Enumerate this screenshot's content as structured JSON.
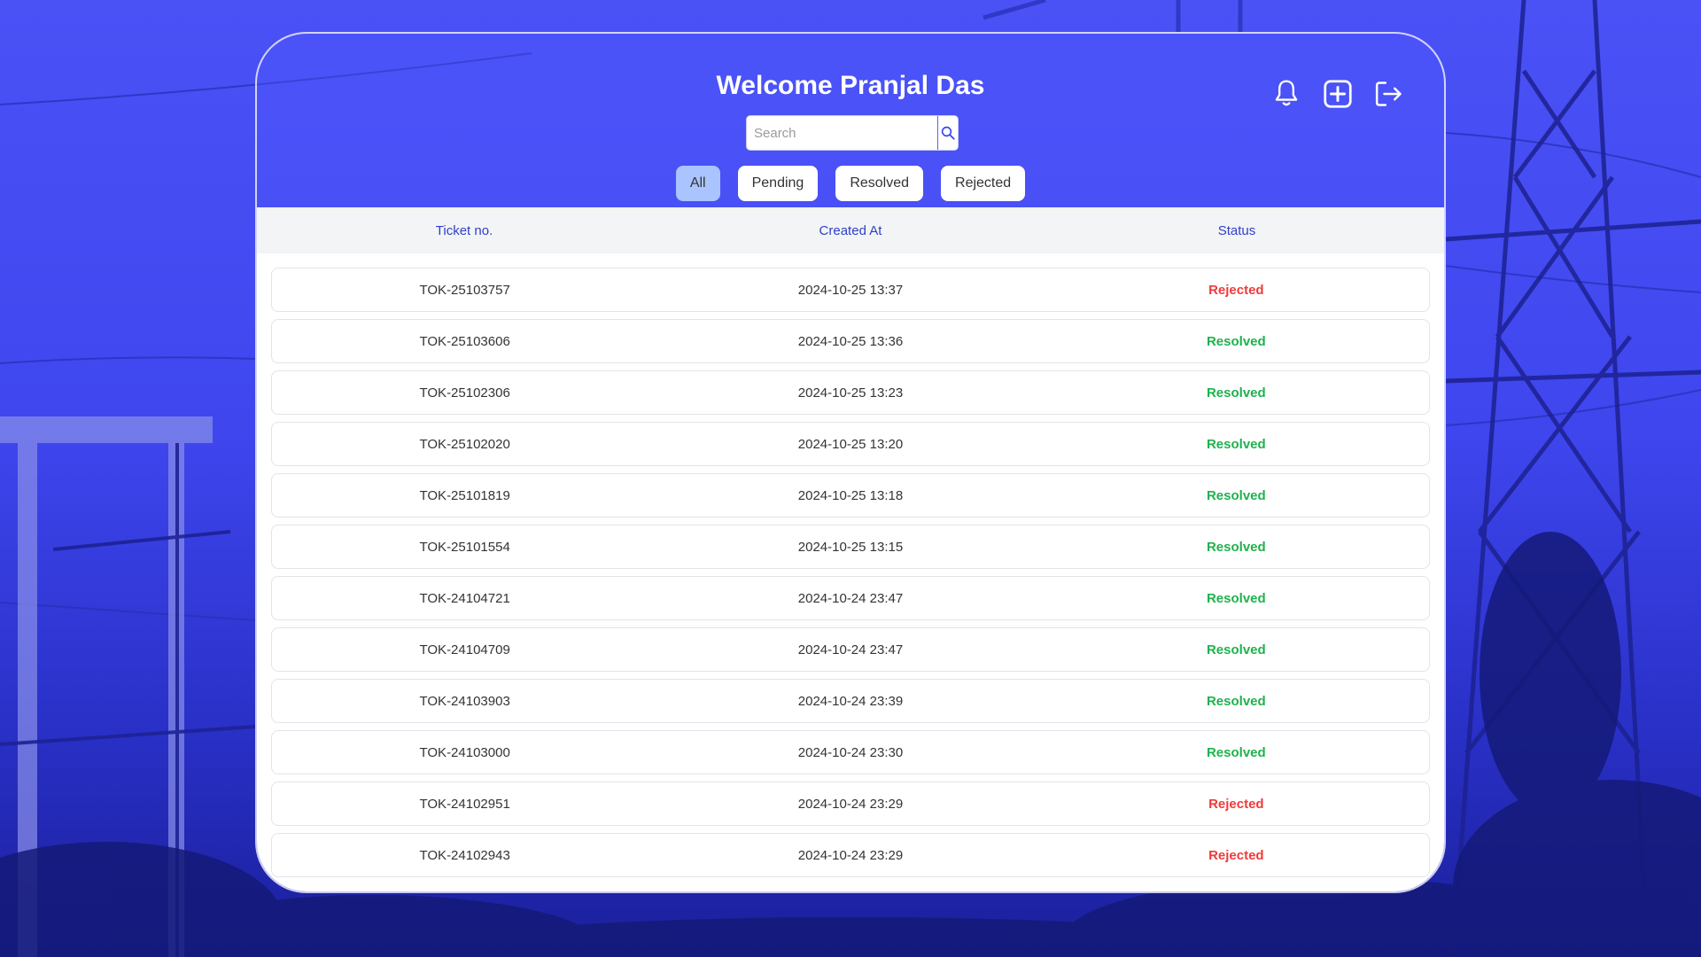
{
  "header": {
    "welcome": "Welcome Pranjal Das",
    "search_placeholder": "Search",
    "icons": [
      "bell-icon",
      "add-square-icon",
      "logout-icon"
    ]
  },
  "filters": [
    {
      "label": "All",
      "active": true
    },
    {
      "label": "Pending",
      "active": false
    },
    {
      "label": "Resolved",
      "active": false
    },
    {
      "label": "Rejected",
      "active": false
    }
  ],
  "table": {
    "columns": [
      "Ticket no.",
      "Created At",
      "Status"
    ],
    "rows": [
      {
        "ticket": "TOK-25103757",
        "created": "2024-10-25 13:37",
        "status": "Rejected"
      },
      {
        "ticket": "TOK-25103606",
        "created": "2024-10-25 13:36",
        "status": "Resolved"
      },
      {
        "ticket": "TOK-25102306",
        "created": "2024-10-25 13:23",
        "status": "Resolved"
      },
      {
        "ticket": "TOK-25102020",
        "created": "2024-10-25 13:20",
        "status": "Resolved"
      },
      {
        "ticket": "TOK-25101819",
        "created": "2024-10-25 13:18",
        "status": "Resolved"
      },
      {
        "ticket": "TOK-25101554",
        "created": "2024-10-25 13:15",
        "status": "Resolved"
      },
      {
        "ticket": "TOK-24104721",
        "created": "2024-10-24 23:47",
        "status": "Resolved"
      },
      {
        "ticket": "TOK-24104709",
        "created": "2024-10-24 23:47",
        "status": "Resolved"
      },
      {
        "ticket": "TOK-24103903",
        "created": "2024-10-24 23:39",
        "status": "Resolved"
      },
      {
        "ticket": "TOK-24103000",
        "created": "2024-10-24 23:30",
        "status": "Resolved"
      },
      {
        "ticket": "TOK-24102951",
        "created": "2024-10-24 23:29",
        "status": "Rejected"
      },
      {
        "ticket": "TOK-24102943",
        "created": "2024-10-24 23:29",
        "status": "Rejected"
      }
    ]
  },
  "colors": {
    "background": "#3f45f0",
    "header_text": "#2f3fc7",
    "rejected": "#ef3b3b",
    "resolved": "#1fb24d",
    "active_filter": "#a9c4ff"
  }
}
